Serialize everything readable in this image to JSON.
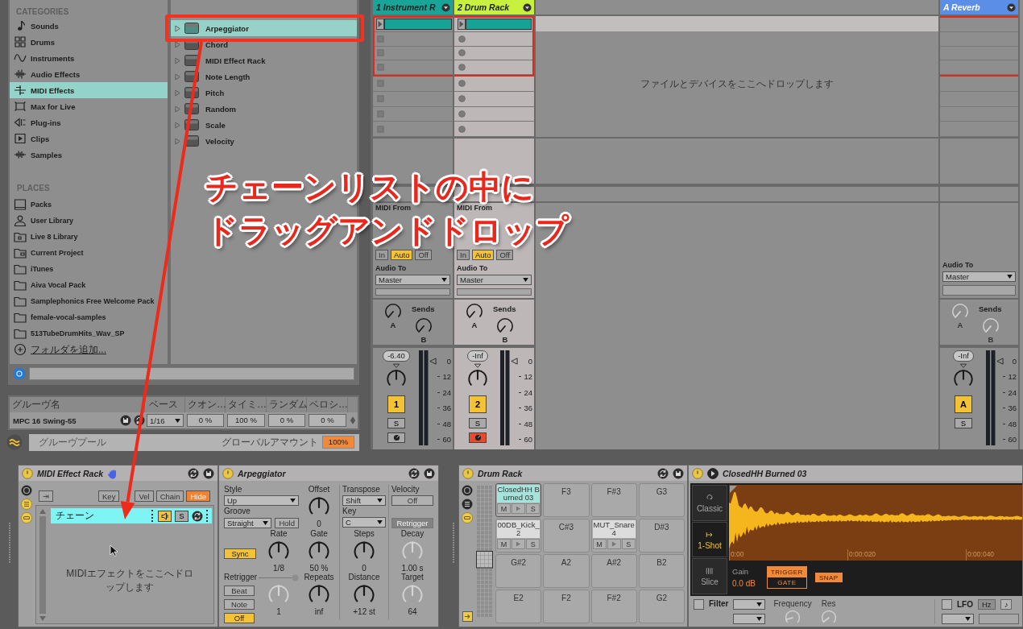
{
  "browser": {
    "categories_heading": "CATEGORIES",
    "categories": [
      {
        "label": "Sounds",
        "selected": false
      },
      {
        "label": "Drums",
        "selected": false
      },
      {
        "label": "Instruments",
        "selected": false
      },
      {
        "label": "Audio Effects",
        "selected": false
      },
      {
        "label": "MIDI Effects",
        "selected": true
      },
      {
        "label": "Max for Live",
        "selected": false
      },
      {
        "label": "Plug-ins",
        "selected": false
      },
      {
        "label": "Clips",
        "selected": false
      },
      {
        "label": "Samples",
        "selected": false
      }
    ],
    "places_heading": "PLACES",
    "places": [
      "Packs",
      "User Library",
      "Live 8 Library",
      "Current Project",
      "iTunes",
      "Aiva Vocal Pack",
      "Samplephonics Free Welcome Pack",
      "female-vocal-samples",
      "513TubeDrumHits_Wav_SP"
    ],
    "add_folder": "フォルダを追加...",
    "items": [
      {
        "label": "Arpeggiator",
        "selected": true
      },
      {
        "label": "Chord",
        "selected": false
      },
      {
        "label": "MIDI Effect Rack",
        "selected": false
      },
      {
        "label": "Note Length",
        "selected": false
      },
      {
        "label": "Pitch",
        "selected": false
      },
      {
        "label": "Random",
        "selected": false
      },
      {
        "label": "Scale",
        "selected": false
      },
      {
        "label": "Velocity",
        "selected": false
      }
    ]
  },
  "groove_pool": {
    "columns": [
      "グルーヴ名",
      "ベース",
      "クオン…",
      "タイミ…",
      "ランダム",
      "ベロシ…"
    ],
    "grooves": [
      {
        "name": "MPC 16 Swing-55",
        "base": "1/16",
        "quantize": "0 %",
        "timing": "100 %",
        "random": "0 %",
        "velocity": "0 %"
      }
    ],
    "title": "グルーヴプール",
    "global_amount_label": "グローバルアマウント",
    "global_amount": "100%"
  },
  "session": {
    "tracks": [
      {
        "name": "1 Instrument R",
        "color": "#18a597",
        "selected": false,
        "armed": false,
        "slots": [
          {
            "clip": true,
            "selected": true
          },
          {
            "clip": false,
            "selected": true
          },
          {
            "clip": false,
            "selected": true
          },
          {
            "clip": false,
            "selected": true
          },
          {
            "clip": false,
            "selected": false
          },
          {
            "clip": false,
            "selected": false
          },
          {
            "clip": false,
            "selected": false
          },
          {
            "clip": false,
            "selected": false
          }
        ],
        "midi_from_label": "MIDI From",
        "monitor": [
          {
            "label": "In",
            "selected": false
          },
          {
            "label": "Auto",
            "selected": true
          },
          {
            "label": "Off",
            "selected": false
          }
        ],
        "audio_to_label": "Audio To",
        "audio_to": "Master",
        "sends_label": "Sends",
        "sends": [
          {
            "label": "A",
            "disabled": false
          },
          {
            "label": "B",
            "disabled": false
          }
        ],
        "volume": "-6.40",
        "activator": "1",
        "solo": "S",
        "meter_scale": [
          "0",
          "12",
          "24",
          "36",
          "48",
          "60"
        ]
      },
      {
        "name": "2 Drum Rack",
        "color": "#c8f03e",
        "selected": true,
        "armed": true,
        "slots": [
          {
            "clip": true,
            "selected": true
          },
          {
            "clip": false,
            "selected": true
          },
          {
            "clip": false,
            "selected": true
          },
          {
            "clip": false,
            "selected": true
          },
          {
            "clip": false,
            "selected": false
          },
          {
            "clip": false,
            "selected": false
          },
          {
            "clip": false,
            "selected": false
          },
          {
            "clip": false,
            "selected": false
          }
        ],
        "midi_from_label": "MIDI From",
        "monitor": [
          {
            "label": "In",
            "selected": false
          },
          {
            "label": "Auto",
            "selected": true
          },
          {
            "label": "Off",
            "selected": false
          }
        ],
        "audio_to_label": "Audio To",
        "audio_to": "Master",
        "sends_label": "Sends",
        "sends": [
          {
            "label": "A",
            "disabled": false
          },
          {
            "label": "B",
            "disabled": false
          }
        ],
        "volume": "-Inf",
        "activator": "2",
        "solo": "S",
        "meter_scale": [
          "0",
          "12",
          "24",
          "36",
          "48",
          "60"
        ]
      }
    ],
    "drop_hint": "ファイルとデバイスをここへドロップします",
    "returns": [
      {
        "name": "A Reverb",
        "color": "#5b8ee6",
        "slots": [
          {
            "selected": true
          },
          {
            "selected": true
          },
          {
            "selected": true
          },
          {
            "selected": true
          },
          {
            "selected": false
          },
          {
            "selected": false
          },
          {
            "selected": false
          },
          {
            "selected": false
          }
        ],
        "audio_to_label": "Audio To",
        "audio_to": "Master",
        "sends_label": "Sends",
        "sends": [
          {
            "label": "A",
            "disabled": true
          },
          {
            "label": "B",
            "disabled": true
          }
        ],
        "volume": "-Inf",
        "activator": "A",
        "solo": "S",
        "meter_scale": [
          "0",
          "12",
          "24",
          "36",
          "48",
          "60"
        ]
      }
    ]
  },
  "devices": {
    "midi_effect_rack": {
      "title": "MIDI Effect Rack",
      "buttons": [
        {
          "label": "Key",
          "selected": false
        },
        {
          "label": "Vel",
          "selected": false
        },
        {
          "label": "Chain",
          "selected": false
        },
        {
          "label": "Hide",
          "selected": true
        }
      ],
      "chains": [
        {
          "name": "チェーン",
          "selected": true,
          "speaker_on": true,
          "solo": "S"
        }
      ],
      "drop_hint": "MIDIエフェクトをここへドロップします"
    },
    "arpeggiator": {
      "title": "Arpeggiator",
      "style_label": "Style",
      "style": "Up",
      "groove_label": "Groove",
      "groove": "Straight",
      "hold": "Hold",
      "offset": {
        "label": "Offset",
        "value": "0",
        "disabled": false
      },
      "transpose_label": "Transpose",
      "transpose": "Shift",
      "key_label": "Key",
      "key": "C",
      "velocity_label": "Velocity",
      "velocity": "Off",
      "velocity_retrigger": {
        "label": "Retrigger",
        "disabled": true
      },
      "sync": {
        "label": "Sync",
        "on": true
      },
      "knobs": [
        {
          "label": "Rate",
          "value": "1/8",
          "disabled": false
        },
        {
          "label": "Gate",
          "value": "50 %",
          "disabled": false
        },
        {
          "label": "Steps",
          "value": "0",
          "disabled": false
        },
        {
          "label": "Decay",
          "value": "1.00 s",
          "disabled": true
        }
      ],
      "retrigger_label": "Retrigger",
      "retrigger_modes": [
        {
          "label": "Beat",
          "selected": false
        },
        {
          "label": "Note",
          "selected": false
        },
        {
          "label": "Off",
          "selected": true
        }
      ],
      "lower_knobs": [
        {
          "value": "1",
          "disabled": true
        },
        {
          "label": "Repeats",
          "value": "inf",
          "disabled": false
        },
        {
          "label": "Distance",
          "value": "+12 st",
          "disabled": false
        },
        {
          "label": "Target",
          "value": "64",
          "disabled": true
        }
      ]
    },
    "drum_rack": {
      "title": "Drum Rack",
      "pads": [
        {
          "name": "ClosedHH Burned 03",
          "loaded": true,
          "selected": true,
          "mute": "M",
          "solo": "S"
        },
        {
          "name": "F3",
          "loaded": false,
          "selected": false
        },
        {
          "name": "F#3",
          "loaded": false,
          "selected": false
        },
        {
          "name": "G3",
          "loaded": false,
          "selected": false
        },
        {
          "name": "00DB_Kick_2",
          "loaded": true,
          "selected": false,
          "mute": "M",
          "solo": "S"
        },
        {
          "name": "C#3",
          "loaded": false,
          "selected": false
        },
        {
          "name": "MUT_Snare4",
          "loaded": true,
          "selected": false,
          "mute": "M",
          "solo": "S"
        },
        {
          "name": "D#3",
          "loaded": false,
          "selected": false
        },
        {
          "name": "G#2",
          "loaded": false,
          "selected": false
        },
        {
          "name": "A2",
          "loaded": false,
          "selected": false
        },
        {
          "name": "A#2",
          "loaded": false,
          "selected": false
        },
        {
          "name": "B2",
          "loaded": false,
          "selected": false
        },
        {
          "name": "E2",
          "loaded": false,
          "selected": false
        },
        {
          "name": "F2",
          "loaded": false,
          "selected": false
        },
        {
          "name": "F#2",
          "loaded": false,
          "selected": false
        },
        {
          "name": "G2",
          "loaded": false,
          "selected": false
        }
      ]
    },
    "simpler": {
      "title": "ClosedHH Burned 03",
      "modes": [
        {
          "label": "Classic",
          "selected": false
        },
        {
          "label": "1-Shot",
          "selected": true
        },
        {
          "label": "Slice",
          "selected": false
        }
      ],
      "ruler": [
        "0:00",
        "0:00:020",
        "0:00:040"
      ],
      "gain_label": "Gain",
      "gain": "0.0 dB",
      "trigger_modes": [
        {
          "label": "TRIGGER",
          "selected": true
        },
        {
          "label": "GATE",
          "selected": false
        }
      ],
      "snap": {
        "label": "SNAP",
        "on": true
      },
      "filter": {
        "label": "Filter",
        "checked": false
      },
      "frequency_label": "Frequency",
      "res_label": "Res",
      "lfo": {
        "label": "LFO",
        "checked": false
      },
      "lfo_units": [
        {
          "label": "Hz",
          "selected": true
        },
        {
          "label": "♪",
          "selected": false
        }
      ]
    }
  },
  "annotation": {
    "lines": [
      "チェーンリストの中に",
      "ドラッグアンドドロップ"
    ]
  }
}
